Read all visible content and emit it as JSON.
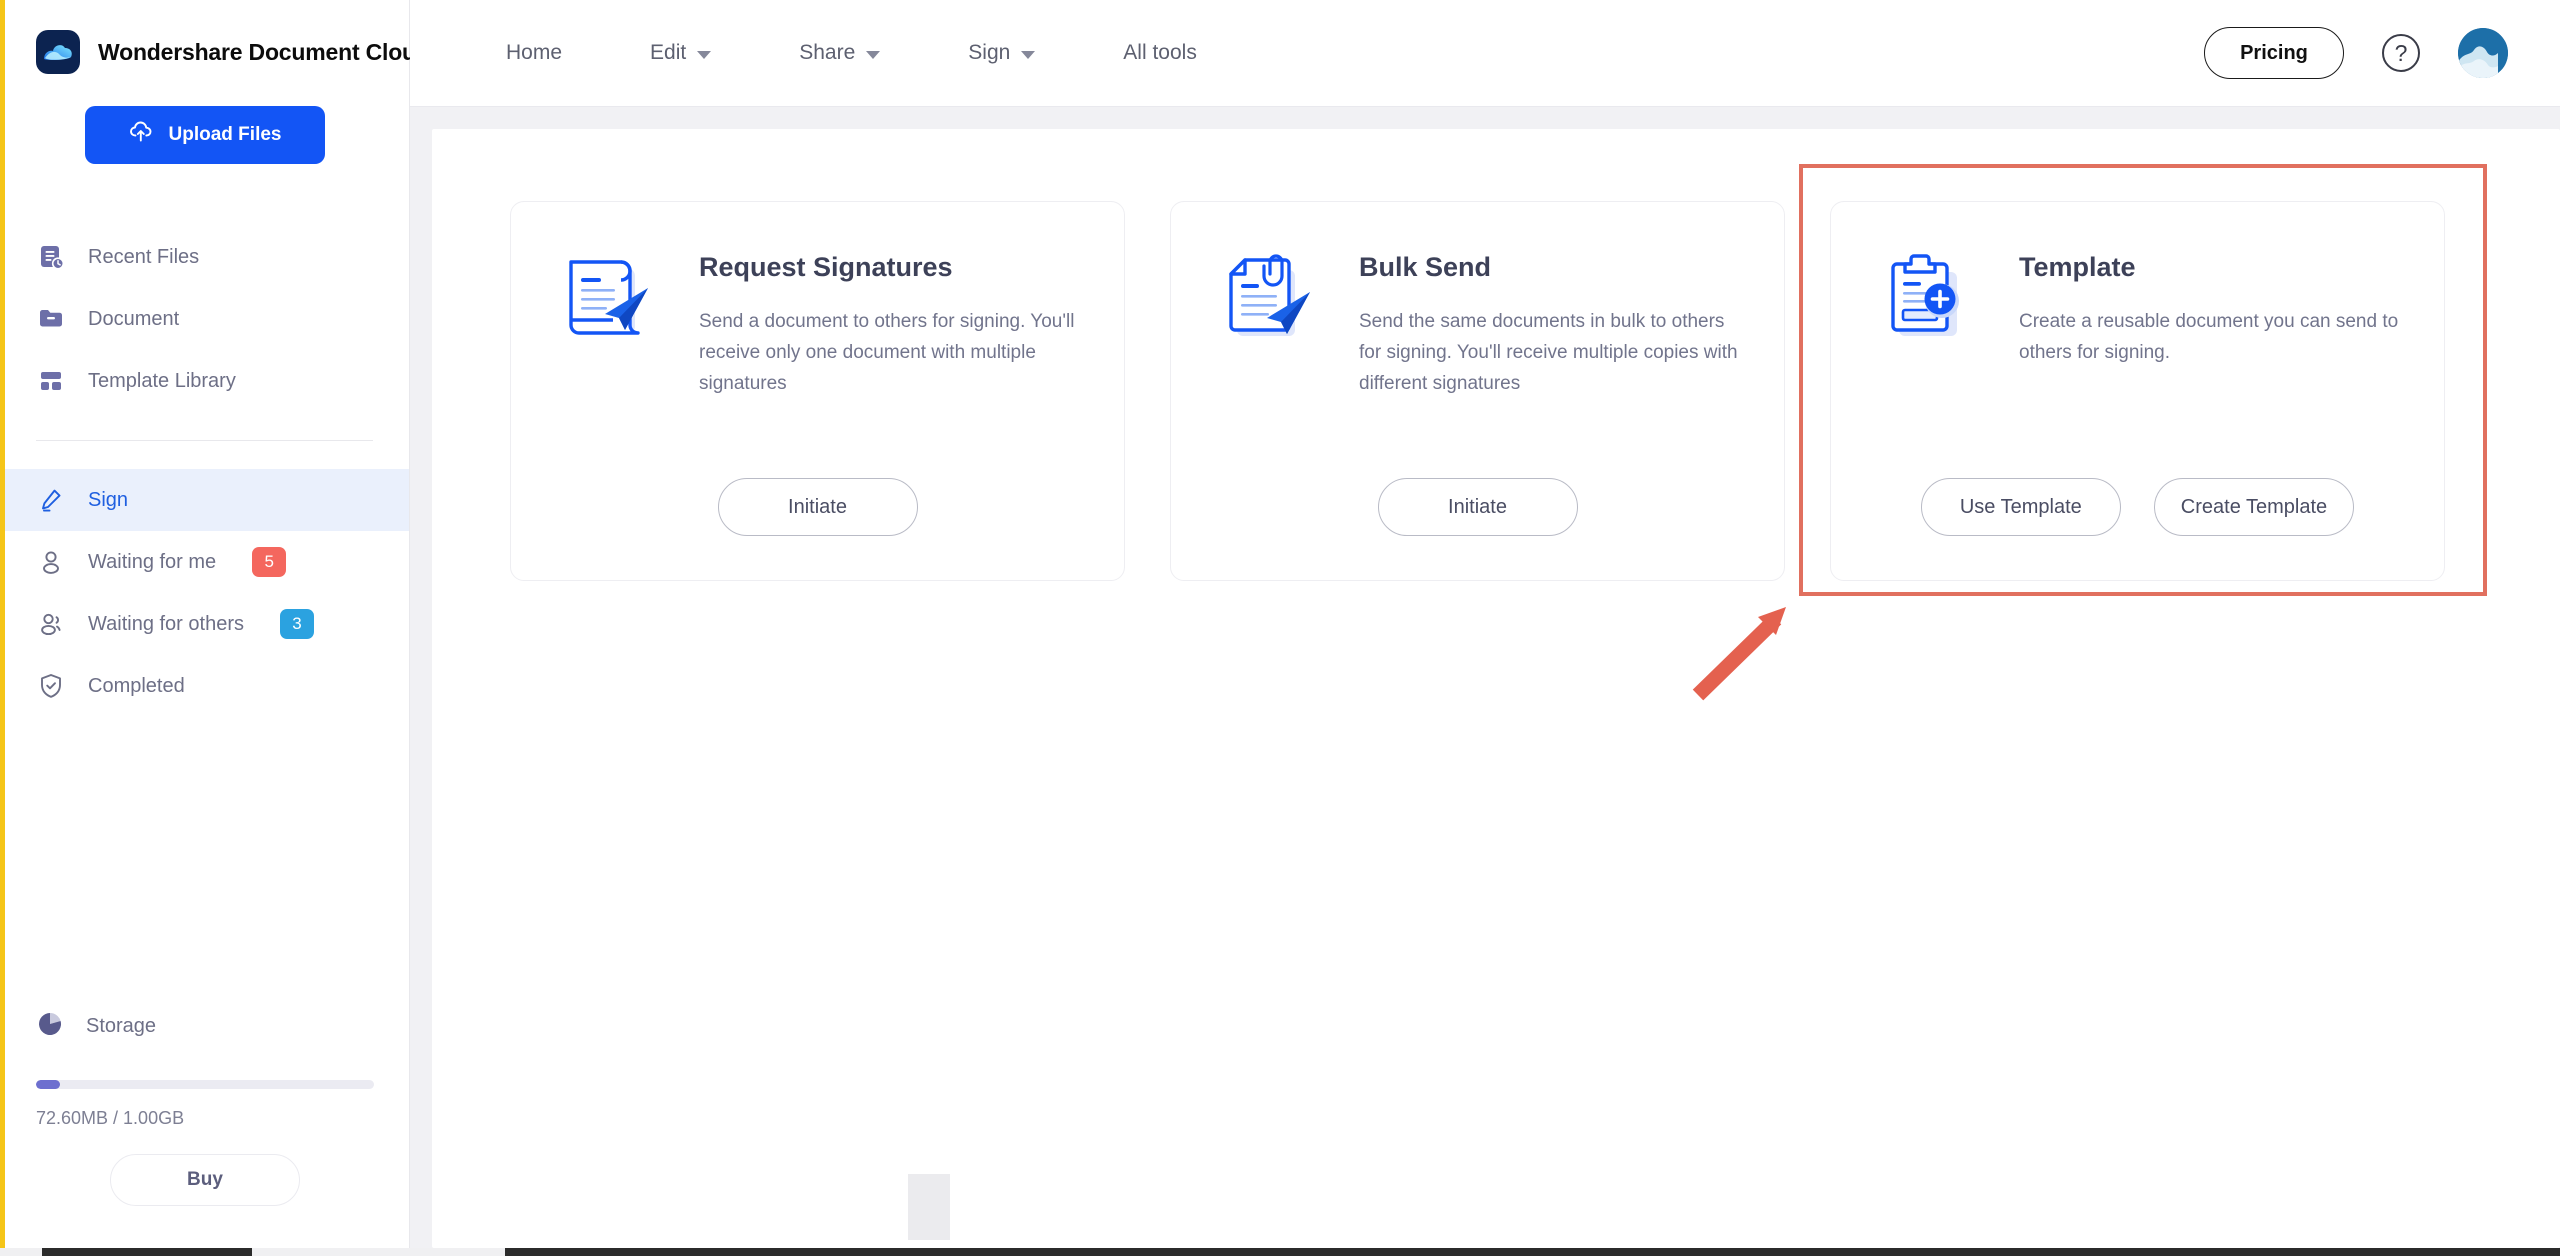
{
  "brand": {
    "name": "Wondershare Document Cloud",
    "logo_icon": "cloud-logo-icon"
  },
  "sidebar": {
    "upload_button": {
      "label": "Upload Files",
      "icon": "cloud-upload-icon"
    },
    "items": [
      {
        "label": "Recent Files",
        "icon": "recent-files-icon",
        "active": false,
        "badge": null
      },
      {
        "label": "Document",
        "icon": "folder-icon",
        "active": false,
        "badge": null
      },
      {
        "label": "Template Library",
        "icon": "template-library-icon",
        "active": false,
        "badge": null
      },
      {
        "label": "Sign",
        "icon": "pencil-icon",
        "active": true,
        "badge": null
      },
      {
        "label": "Waiting for me",
        "icon": "user-icon",
        "active": false,
        "badge": "5",
        "badge_color": "#f4675e"
      },
      {
        "label": "Waiting for others",
        "icon": "users-icon",
        "active": false,
        "badge": "3",
        "badge_color": "#2ba2e0"
      },
      {
        "label": "Completed",
        "icon": "shield-check-icon",
        "active": false,
        "badge": null
      }
    ],
    "storage": {
      "label": "Storage",
      "icon": "pie-chart-icon",
      "usage_text": "72.60MB / 1.00GB",
      "used_percent": 7,
      "buy_label": "Buy"
    }
  },
  "topbar": {
    "nav": [
      {
        "label": "Home",
        "has_dropdown": false
      },
      {
        "label": "Edit",
        "has_dropdown": true
      },
      {
        "label": "Share",
        "has_dropdown": true
      },
      {
        "label": "Sign",
        "has_dropdown": true
      },
      {
        "label": "All tools",
        "has_dropdown": false
      }
    ],
    "pricing_label": "Pricing",
    "help_icon": "question-mark-icon",
    "help_glyph": "?",
    "avatar_icon": "user-avatar-icon"
  },
  "main": {
    "cards": [
      {
        "title": "Request Signatures",
        "description": "Send a document to others for signing. You'll receive only one document with multiple signatures",
        "icon": "scroll-document-send-icon",
        "buttons": [
          "Initiate"
        ]
      },
      {
        "title": "Bulk Send",
        "description": "Send the same documents in bulk to others for signing. You'll receive multiple copies with different signatures",
        "icon": "document-clip-send-icon",
        "buttons": [
          "Initiate"
        ]
      },
      {
        "title": "Template",
        "description": "Create a reusable document you can send to others for signing.",
        "icon": "clipboard-plus-icon",
        "buttons": [
          "Use Template",
          "Create Template"
        ],
        "highlighted": true
      }
    ]
  },
  "annotations": {
    "highlight_color": "#e1705f",
    "arrow_color": "#e4614f",
    "arrow_target": "Template card"
  },
  "colors": {
    "brand_blue": "#1355f5",
    "active_nav_blue": "#1f5fe0",
    "active_nav_bg": "#eaf0fc",
    "sidebar_text": "#6d6f86",
    "card_title": "#3d4158",
    "card_desc": "#71748c",
    "storage_fill": "#6d6fcf",
    "page_bg": "#f1f1f4"
  }
}
